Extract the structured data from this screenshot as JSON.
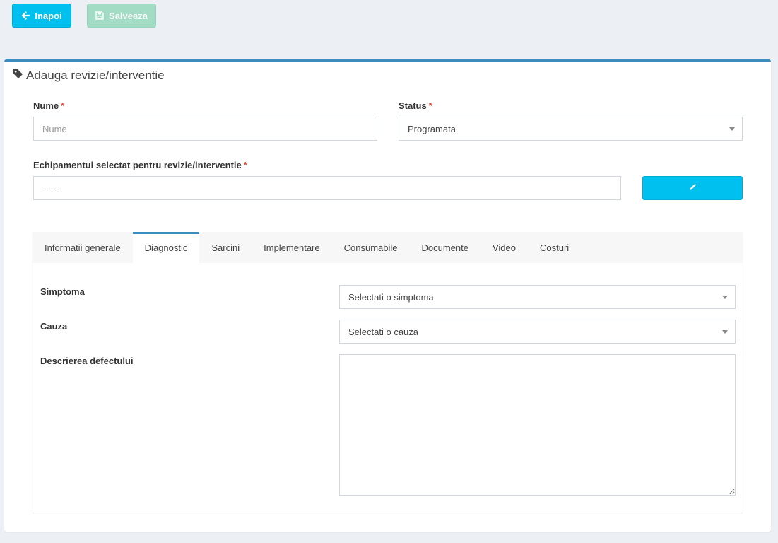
{
  "toolbar": {
    "back_label": "Inapoi",
    "save_label": "Salveaza"
  },
  "form": {
    "title": "Adauga revizie/interventie",
    "nume": {
      "label": "Nume",
      "required_mark": "*",
      "placeholder": "Nume",
      "value": ""
    },
    "status": {
      "label": "Status",
      "required_mark": "*",
      "value": "Programata"
    },
    "echipament": {
      "label": "Echipamentul selectat pentru revizie/interventie",
      "required_mark": "*",
      "value": "-----"
    }
  },
  "tabs": [
    {
      "label": "Informatii generale",
      "active": false
    },
    {
      "label": "Diagnostic",
      "active": true
    },
    {
      "label": "Sarcini",
      "active": false
    },
    {
      "label": "Implementare",
      "active": false
    },
    {
      "label": "Consumabile",
      "active": false
    },
    {
      "label": "Documente",
      "active": false
    },
    {
      "label": "Video",
      "active": false
    },
    {
      "label": "Costuri",
      "active": false
    }
  ],
  "diagnostic": {
    "simptoma": {
      "label": "Simptoma",
      "value": "Selectati o simptoma"
    },
    "cauza": {
      "label": "Cauza",
      "value": "Selectati o cauza"
    },
    "descriere": {
      "label": "Descrierea defectului",
      "value": ""
    }
  },
  "colors": {
    "primary_info": "#00c0ef",
    "success_disabled": "#a3dcc4",
    "box_border": "#3c8dbc",
    "required": "#dd4b39"
  },
  "icons": {
    "back": "arrow-left-icon",
    "save": "floppy-disk-icon",
    "title": "tag-icon",
    "edit": "pencil-icon"
  }
}
